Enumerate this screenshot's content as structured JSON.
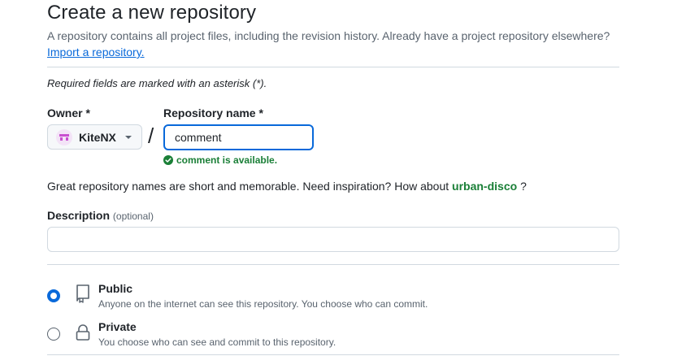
{
  "header": {
    "title": "Create a new repository",
    "subtitle": "A repository contains all project files, including the revision history. Already have a project repository elsewhere?",
    "import_link": "Import a repository."
  },
  "required_note": "Required fields are marked with an asterisk (*).",
  "owner": {
    "label": "Owner *",
    "value": "KiteNX"
  },
  "separator": "/",
  "repo_name": {
    "label": "Repository name *",
    "value": "comment",
    "availability": "comment is available."
  },
  "inspiration": {
    "prefix": "Great repository names are short and memorable. Need inspiration? How about",
    "suggestion": "urban-disco",
    "suffix": "?"
  },
  "description": {
    "label": "Description",
    "optional": "(optional)",
    "value": "",
    "placeholder": ""
  },
  "visibility": {
    "options": [
      {
        "title": "Public",
        "description": "Anyone on the internet can see this repository. You choose who can commit.",
        "selected": true,
        "icon": "repo-book-icon"
      },
      {
        "title": "Private",
        "description": "You choose who can see and commit to this repository.",
        "selected": false,
        "icon": "lock-icon"
      }
    ]
  },
  "colors": {
    "accent": "#0969da",
    "success": "#1a7f37",
    "muted": "#59636e",
    "border": "#d1d9e0"
  }
}
